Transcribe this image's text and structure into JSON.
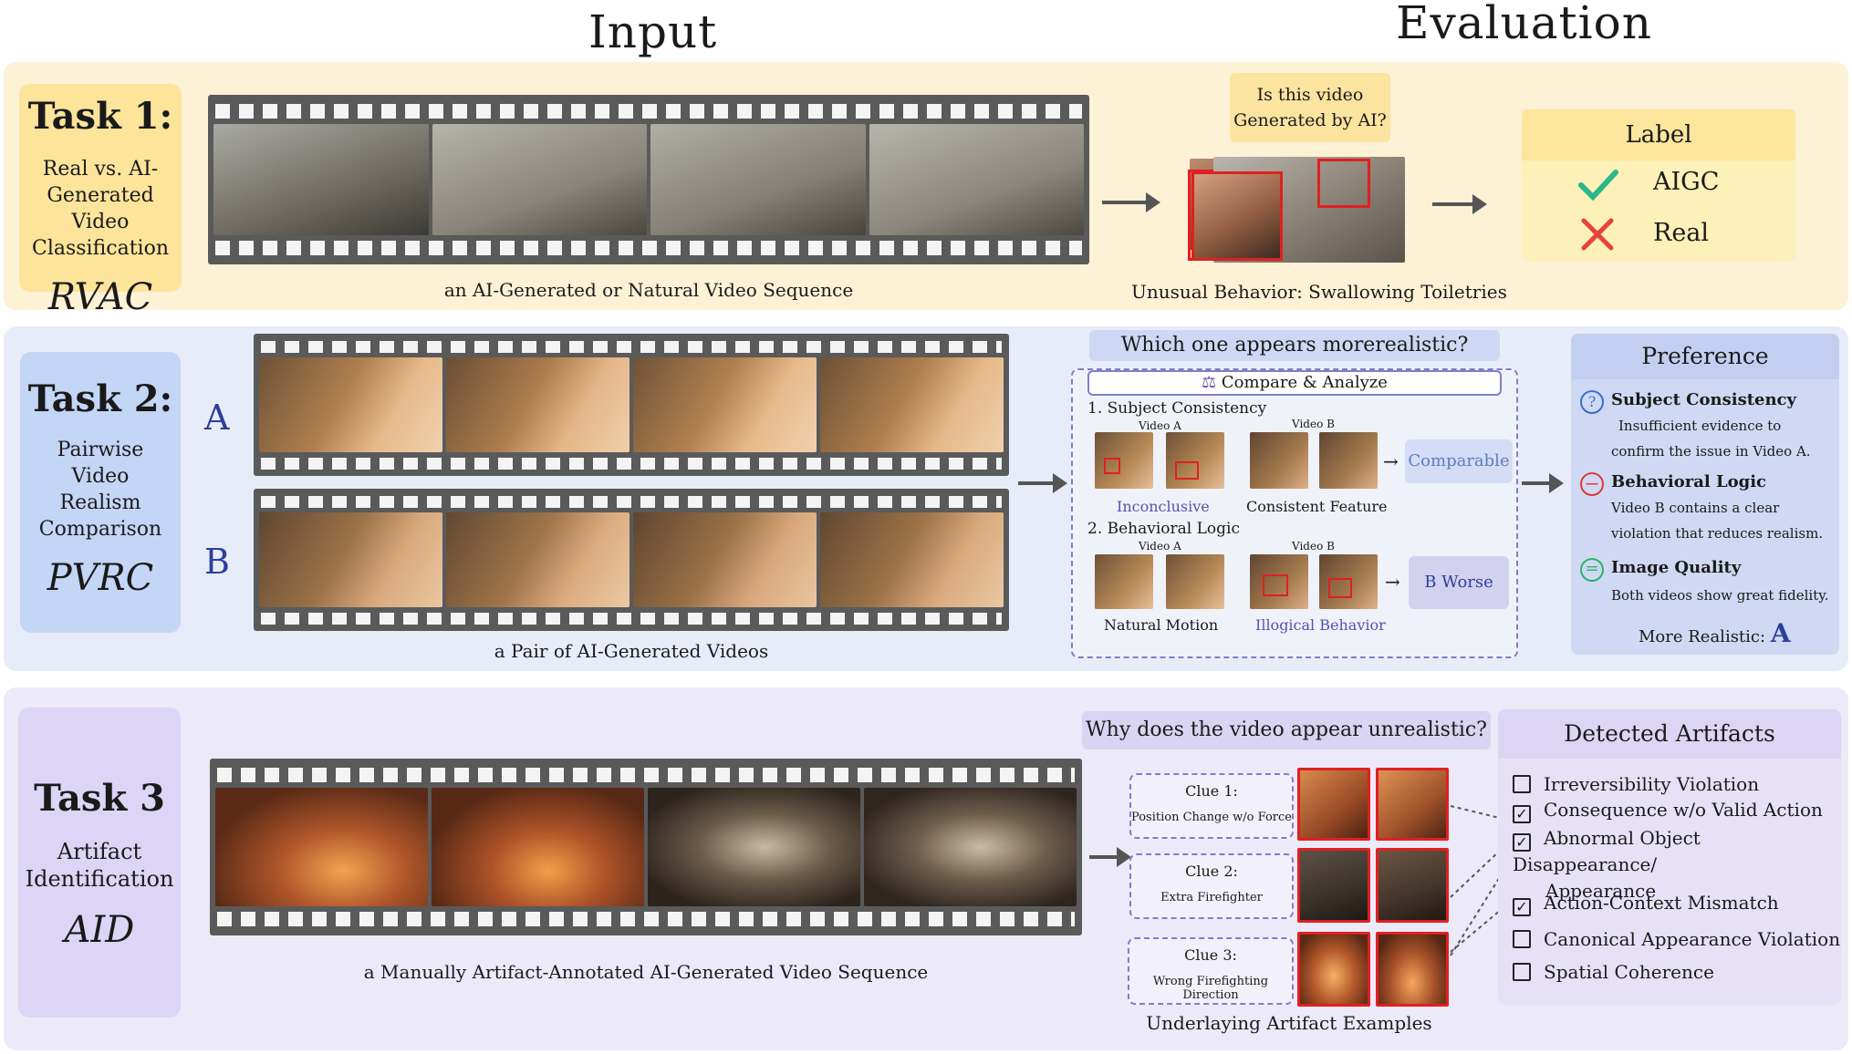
{
  "headings": {
    "input": "Input",
    "evaluation": "Evaluation"
  },
  "colors": {
    "task1_panel": "#fdf1d6",
    "task1_card": "#fde49b",
    "task2_panel": "#e8ecf8",
    "task2_card": "#c4d6f6",
    "task3_panel": "#ece9f8",
    "task3_card": "#dcd5f5",
    "accent_blue": "#2b3f9c",
    "check_green": "#28b88a",
    "cross_red": "#e5423c"
  },
  "task1": {
    "title": "Task 1:",
    "subtitle_lines": [
      "Real vs. AI-",
      "Generated Video",
      "Classification"
    ],
    "abbr": "RVAC",
    "caption": "an AI-Generated or Natural Video Sequence",
    "question_lines": [
      "Is this video",
      "Generated by AI?"
    ],
    "eval_caption": "Unusual Behavior: Swallowing Toiletries",
    "label_title": "Label",
    "label_options": [
      {
        "icon": "check-icon",
        "text": "AIGC"
      },
      {
        "icon": "cross-icon",
        "text": "Real"
      }
    ]
  },
  "task2": {
    "title": "Task 2:",
    "subtitle_lines": [
      "Pairwise",
      "Video",
      "Realism",
      "Comparison"
    ],
    "abbr": "PVRC",
    "video_a_letter": "A",
    "video_b_letter": "B",
    "caption": "a Pair of AI-Generated Videos",
    "question": "Which one appears morerealistic?",
    "compare_title": "Compare & Analyze",
    "sections": [
      {
        "heading": "1. Subject Consistency",
        "video_a": "Video A",
        "video_b": "Video B",
        "a_caption": "Inconclusive",
        "b_caption": "Consistent Feature",
        "result": "Comparable"
      },
      {
        "heading": "2. Behavioral Logic",
        "video_a": "Video A",
        "video_b": "Video B",
        "a_caption": "Natural Motion",
        "b_caption": "Illogical Behavior",
        "result": "B Worse"
      }
    ],
    "preference": {
      "title": "Preference",
      "items": [
        {
          "icon": "question-icon",
          "title": "Subject Consistency",
          "desc_lines": [
            "Insufficient evidence to",
            "confirm the issue in Video A."
          ]
        },
        {
          "icon": "minus-icon",
          "title": "Behavioral Logic",
          "desc_lines": [
            "Video B contains a clear",
            "violation that reduces realism."
          ]
        },
        {
          "icon": "equal-icon",
          "title": "Image Quality",
          "desc_lines": [
            "Both videos show great fidelity."
          ]
        }
      ],
      "verdict_label": "More Realistic:",
      "verdict_value": "A"
    }
  },
  "task3": {
    "title": "Task 3",
    "subtitle_lines": [
      "Artifact",
      "Identification"
    ],
    "abbr": "AID",
    "caption": "a Manually Artifact-Annotated AI-Generated Video Sequence",
    "question": "Why does the video appear unrealistic?",
    "clues": [
      {
        "title": "Clue 1:",
        "desc": "Position Change w/o Force"
      },
      {
        "title": "Clue 2:",
        "desc": "Extra Firefighter"
      },
      {
        "title": "Clue 3:",
        "desc": "Wrong Firefighting Direction"
      }
    ],
    "examples_caption": "Underlaying Artifact Examples",
    "artifacts_title": "Detected Artifacts",
    "artifacts": [
      {
        "lines": [
          "Irreversibility Violation"
        ],
        "checked": false
      },
      {
        "lines": [
          "Consequence w/o Valid Action"
        ],
        "checked": true
      },
      {
        "lines": [
          "Abnormal Object Disappearance/",
          "Appearance"
        ],
        "checked": true
      },
      {
        "lines": [
          "Action-Context Mismatch"
        ],
        "checked": true
      },
      {
        "lines": [
          "Canonical Appearance Violation"
        ],
        "checked": false
      },
      {
        "lines": [
          "Spatial Coherence"
        ],
        "checked": false
      }
    ]
  }
}
